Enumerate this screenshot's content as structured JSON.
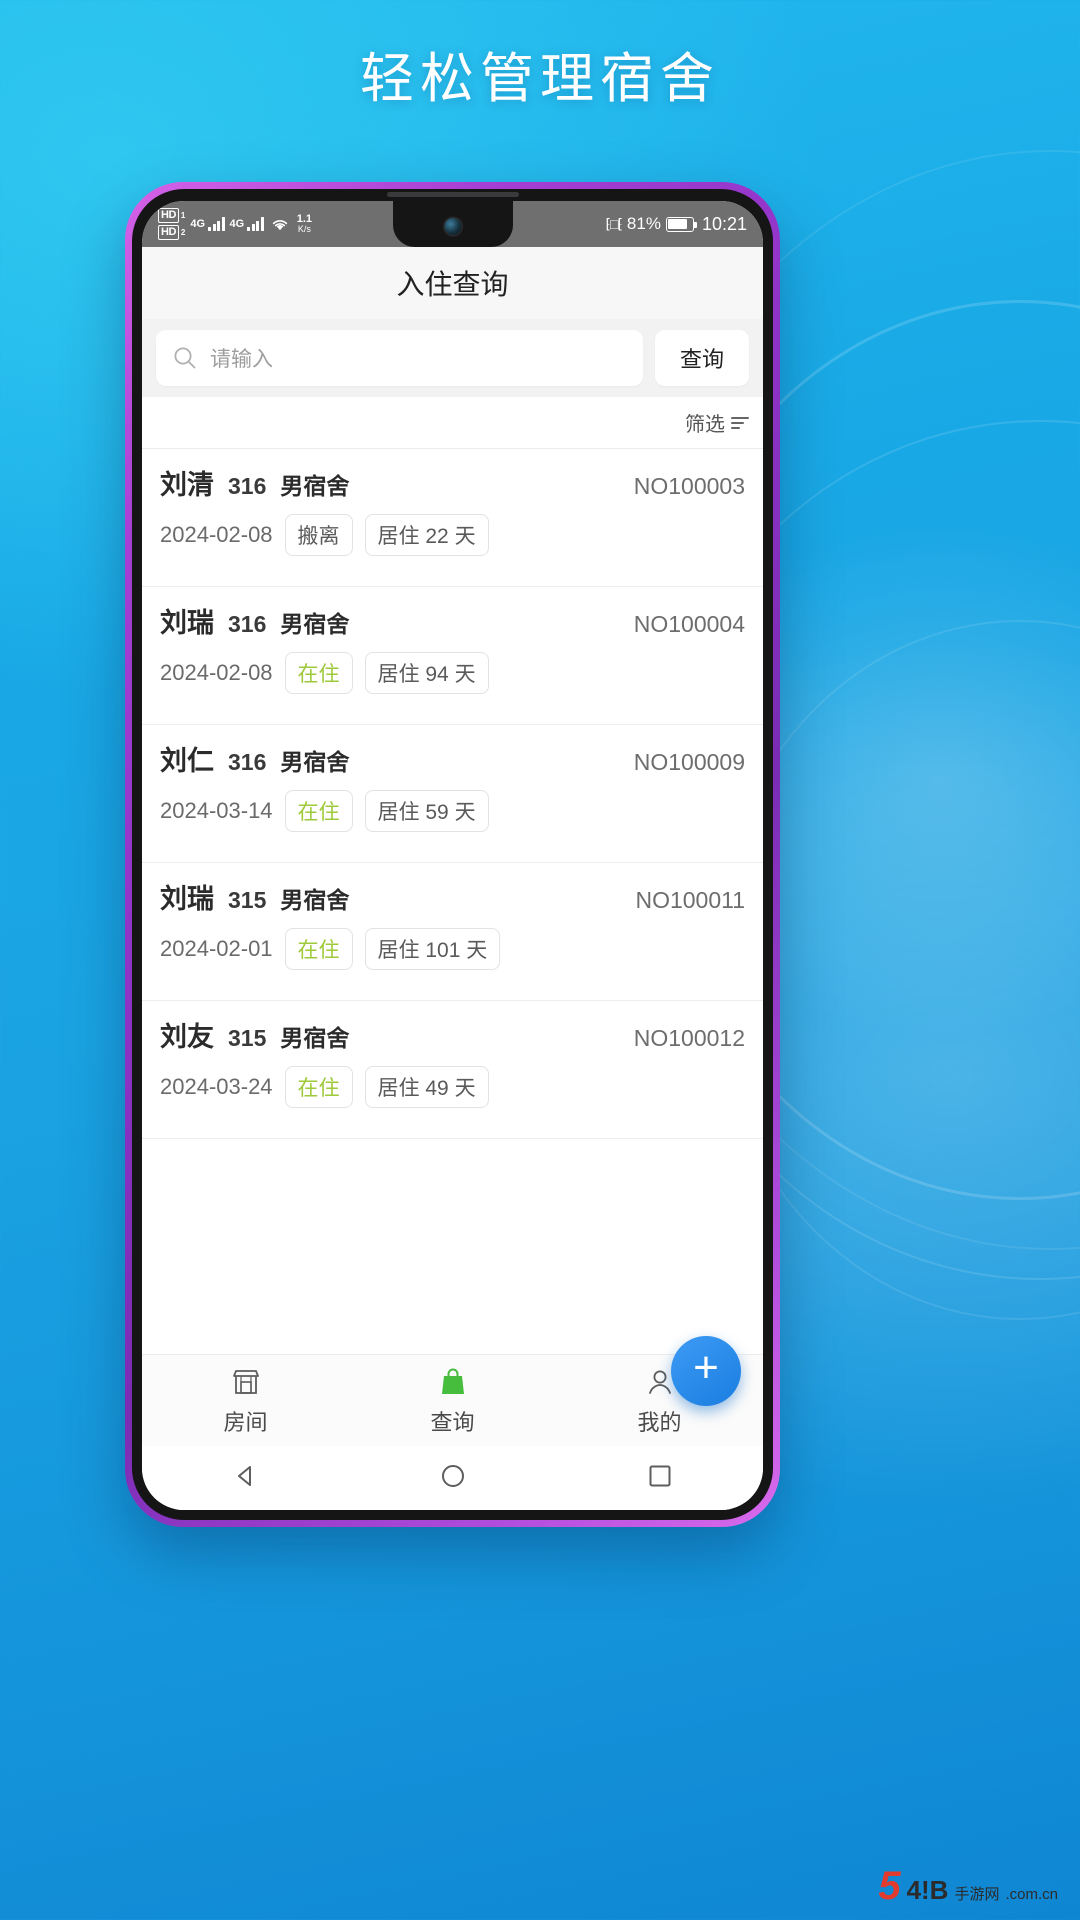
{
  "headline": "轻松管理宿舍",
  "status_bar": {
    "hd1_label": "HD",
    "hd1_sub": "1",
    "hd2_label": "HD",
    "hd2_sub": "2",
    "net1": "4G",
    "net2": "4G",
    "data_rate_value": "1.1",
    "data_rate_unit": "K/s",
    "battery_percent": "81%",
    "battery_level": 81,
    "time": "10:21",
    "wifi_icon": "wifi-icon",
    "vibrate_icon": "vibrate-icon",
    "battery_icon": "battery-icon"
  },
  "appbar": {
    "title": "入住查询"
  },
  "search": {
    "placeholder": "请输入",
    "value": "",
    "icon": "search-icon",
    "query_button": "查询"
  },
  "filter": {
    "label": "筛选",
    "icon": "filter-list-icon"
  },
  "list": {
    "rows": [
      {
        "name": "刘清",
        "room": "316",
        "type": "男宿舍",
        "no": "NO100003",
        "date": "2024-02-08",
        "status": "搬离",
        "status_kind": "out",
        "stay": "居住 22 天"
      },
      {
        "name": "刘瑞",
        "room": "316",
        "type": "男宿舍",
        "no": "NO100004",
        "date": "2024-02-08",
        "status": "在住",
        "status_kind": "in",
        "stay": "居住 94 天"
      },
      {
        "name": "刘仁",
        "room": "316",
        "type": "男宿舍",
        "no": "NO100009",
        "date": "2024-03-14",
        "status": "在住",
        "status_kind": "in",
        "stay": "居住 59 天"
      },
      {
        "name": "刘瑞",
        "room": "315",
        "type": "男宿舍",
        "no": "NO100011",
        "date": "2024-02-01",
        "status": "在住",
        "status_kind": "in",
        "stay": "居住 101 天"
      },
      {
        "name": "刘友",
        "room": "315",
        "type": "男宿舍",
        "no": "NO100012",
        "date": "2024-03-24",
        "status": "在住",
        "status_kind": "in",
        "stay": "居住 49 天"
      }
    ]
  },
  "fab": {
    "label": "+",
    "icon": "plus-icon"
  },
  "tabbar": {
    "tabs": [
      {
        "label": "房间",
        "icon": "store-icon",
        "active": false
      },
      {
        "label": "查询",
        "icon": "bag-icon",
        "active": true
      },
      {
        "label": "我的",
        "icon": "person-icon",
        "active": false
      }
    ]
  },
  "navbar": {
    "back": "back-triangle-icon",
    "home": "home-circle-icon",
    "recent": "recent-square-icon"
  },
  "watermark": {
    "num": "5",
    "mid": "4!B",
    "cn": "手游网",
    "domain": ".com.cn"
  },
  "colors": {
    "background_blue": "#19a9e6",
    "bezel_purple": "#a63fd4",
    "accent_blue": "#1a7de0",
    "status_in_green": "#9ec93a",
    "watermark_red": "#e23b2e"
  }
}
